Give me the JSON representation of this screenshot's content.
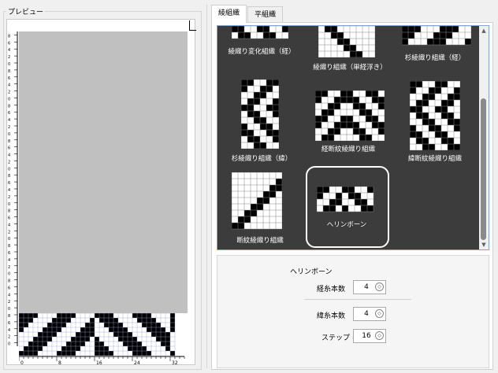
{
  "preview": {
    "title": "プレビュー",
    "vruler_labels": [
      "8",
      "6",
      "4",
      "2",
      "0",
      "8",
      "6",
      "4",
      "2",
      "0",
      "8",
      "6",
      "4",
      "2",
      "0",
      "8",
      "6",
      "4",
      "2",
      "0",
      "8",
      "6",
      "4",
      "2",
      "0",
      "8",
      "6",
      "4",
      "2",
      "0",
      "8",
      "6",
      "4",
      "2",
      "0",
      "8",
      "6",
      "4",
      "2",
      "0",
      "8",
      "6",
      "4",
      "2",
      "0"
    ],
    "hruler_labels": [
      "0",
      "8",
      "16",
      "24",
      "32"
    ]
  },
  "tabs": [
    {
      "label": "綾組織",
      "active": true
    },
    {
      "label": "平組織",
      "active": false
    }
  ],
  "gallery": {
    "items": [
      {
        "name": "twill-variation-warp",
        "label": "綾織り変化組織（経）"
      },
      {
        "name": "twill-warp-float",
        "label": "綾織り組織（単経浮き）"
      },
      {
        "name": "cedar-twill-warp",
        "label": "杉綾織り組織（経）"
      },
      {
        "name": "cedar-twill-weft",
        "label": "杉綾織り組織（緯）"
      },
      {
        "name": "warp-broken-twill",
        "label": "経断紋綾織り組織"
      },
      {
        "name": "weft-broken-twill",
        "label": "緯断紋綾織り組織"
      },
      {
        "name": "broken-twill",
        "label": "断紋綾織り組織"
      },
      {
        "name": "herringbone",
        "label": "ヘリンボーン",
        "selected": true
      }
    ]
  },
  "params": {
    "title": "ヘリンボーン",
    "warp_count_label": "経糸本数",
    "warp_count": "4",
    "weft_count_label": "緯糸本数",
    "weft_count": "4",
    "step_label": "ステップ =",
    "step": "16"
  },
  "colors": {
    "accent": "#7aa6d8",
    "gallery_bg": "#3c3c3c",
    "preview_gray": "#c0c0c0"
  }
}
